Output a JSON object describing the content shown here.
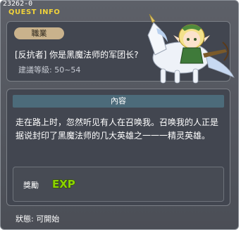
{
  "window": {
    "quest_id": "23262-0",
    "title": "QUEST INFO"
  },
  "quest": {
    "category_tag": "職業",
    "name": "[反抗者] 你是黑魔法师的军团长?",
    "level_range": "建議等級: 50~54"
  },
  "content": {
    "header": "內容",
    "description": "走在路上时，忽然听见有人在召唤我。召唤我的人正是据说封印了黑魔法师的几大英雄之一一一精灵英雄。"
  },
  "reward": {
    "label": "獎勵",
    "exp_icon_text": "EXP"
  },
  "status": {
    "text": "狀態: 可開始"
  },
  "colors": {
    "title_yellow": "#f0d23a",
    "window_bg": "#5a5d65",
    "panel_bg": "#424650",
    "header_bg": "#4c6b7a",
    "tag_bg": "#c9b28c",
    "exp_green": "#8cd400"
  }
}
